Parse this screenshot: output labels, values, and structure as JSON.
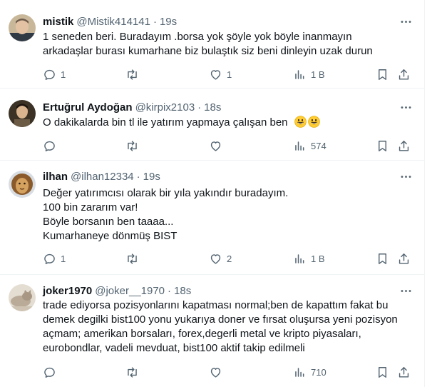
{
  "tweets": [
    {
      "name": "mistik",
      "handle": "@Mistik414141",
      "time": "19s",
      "lines": [
        "1 seneden beri. Buradayım  .borsa yok şöyle yok böyle inanmayın",
        "arkadaşlar burası kumarhane biz bulaştık siz beni dinleyin uzak durun"
      ],
      "replies": "1",
      "retweets": "",
      "likes": "1",
      "views": "1 B"
    },
    {
      "name": "Ertuğrul Aydoğan",
      "handle": "@kirpix2103",
      "time": "18s",
      "lines": [
        "O dakikalarda bin tl ile yatırım yapmaya çalışan ben"
      ],
      "replies": "",
      "retweets": "",
      "likes": "",
      "views": "574"
    },
    {
      "name": "ilhan",
      "handle": "@ilhan12334",
      "time": "19s",
      "lines": [
        "Değer yatırımcısı olarak bir yıla yakındır buradayım.",
        "100 bin zararım var!",
        "Böyle borsanın ben taaaa...",
        "Kumarhaneye dönmüş BIST"
      ],
      "replies": "1",
      "retweets": "",
      "likes": "2",
      "views": "1 B"
    },
    {
      "name": "joker1970",
      "handle": "@joker__1970",
      "time": "18s",
      "lines": [
        "trade ediyorsa pozisyonlarını kapatması normal;ben de kapattım fakat bu",
        "demek degilki bist100 yonu yukarıya doner ve  fırsat oluşursa yeni pozisyon",
        "açmam; amerikan borsaları, forex,degerli metal ve kripto piyasaları,",
        "eurobondlar, vadeli mevduat, bist100 aktif takip edilmeli"
      ],
      "replies": "",
      "retweets": "",
      "likes": "",
      "views": "710"
    }
  ],
  "icons": {
    "reply": "reply-icon",
    "retweet": "retweet-icon",
    "like": "heart-icon",
    "views": "views-icon",
    "bookmark": "bookmark-icon",
    "share": "share-icon",
    "more": "more-icon",
    "emoji": "grinning-face-emoji"
  },
  "colors": {
    "text": "#0f1419",
    "secondary": "#536471",
    "divider": "#eff3f4"
  }
}
